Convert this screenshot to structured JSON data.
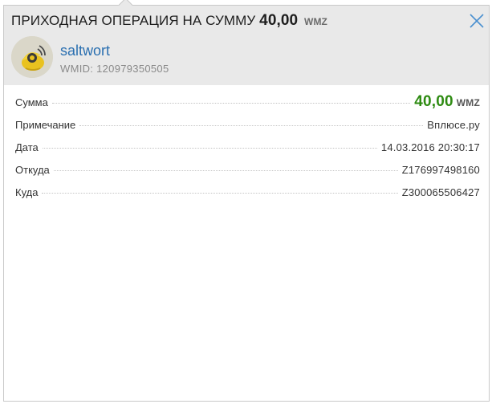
{
  "dialog": {
    "title_prefix": "ПРИХОДНАЯ ОПЕРАЦИЯ НА СУММУ",
    "title_amount": "40,00",
    "title_currency": "WMZ",
    "close_icon": "close-icon"
  },
  "user": {
    "name": "saltwort",
    "wmid": "WMID: 120979350505",
    "avatar_icon": "webmoney-logo-icon"
  },
  "details": {
    "sum": {
      "label": "Сумма",
      "amount": "40,00",
      "currency": "WMZ"
    },
    "note": {
      "label": "Примечание",
      "value": "Вплюсе.ру"
    },
    "date": {
      "label": "Дата",
      "value": "14.03.2016 20:30:17"
    },
    "from": {
      "label": "Откуда",
      "value": "Z176997498160"
    },
    "to": {
      "label": "Куда",
      "value": "Z300065506427"
    }
  },
  "colors": {
    "accent_link": "#2a6fb0",
    "amount_green": "#2e8b12",
    "header_bg": "#e9e9e9"
  }
}
